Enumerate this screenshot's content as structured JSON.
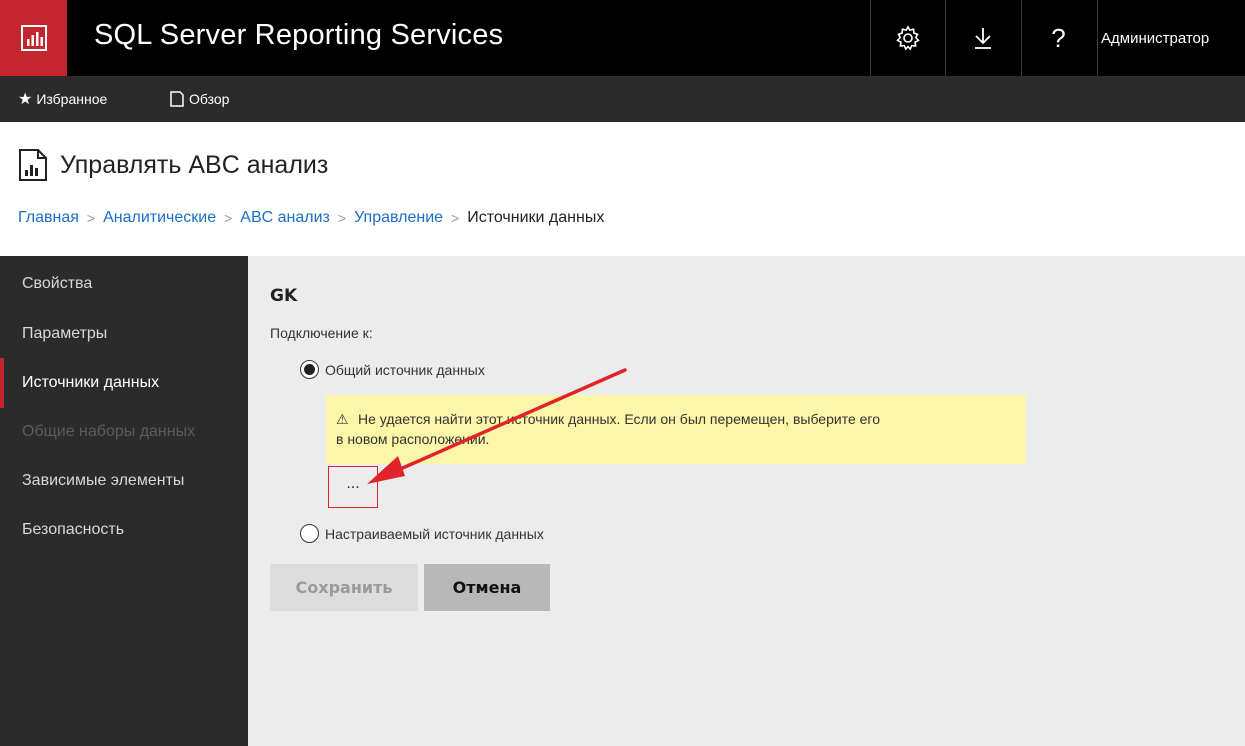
{
  "app": {
    "title": "SQL Server Reporting Services",
    "user": "Администратор"
  },
  "header_buttons": {
    "settings": "settings-gear-icon",
    "download": "download-icon",
    "help": "?"
  },
  "subnav": {
    "favorites": "Избранное",
    "browse": "Обзор"
  },
  "page": {
    "title": "Управлять ABC анализ"
  },
  "breadcrumb": {
    "items": [
      "Главная",
      "Аналитические",
      "ABC анализ",
      "Управление"
    ],
    "current": "Источники данных"
  },
  "sidebar": {
    "items": [
      {
        "label": "Свойства",
        "state": "normal"
      },
      {
        "label": "Параметры",
        "state": "normal"
      },
      {
        "label": "Источники данных",
        "state": "active"
      },
      {
        "label": "Общие наборы данных",
        "state": "disabled"
      },
      {
        "label": "Зависимые элементы",
        "state": "normal"
      },
      {
        "label": "Безопасность",
        "state": "normal"
      }
    ]
  },
  "form": {
    "datasource_name": "GK",
    "connect_label": "Подключение к:",
    "options": {
      "shared": "Общий источник данных",
      "custom": "Настраиваемый источник данных"
    },
    "selected_option": "shared",
    "warning": {
      "icon": "⚠",
      "line1": "Не удается найти этот источник данных. Если он был перемещен, выберите его",
      "line2": "в новом расположении."
    },
    "browse_label": "...",
    "save_label": "Сохранить",
    "cancel_label": "Отмена"
  },
  "colors": {
    "brand_red": "#c4262e",
    "topbar": "#000000",
    "subbar": "#2b2b2b",
    "link": "#1a6fc9",
    "warning_bg": "#fdf6a8",
    "annotation": "#e0242a"
  }
}
